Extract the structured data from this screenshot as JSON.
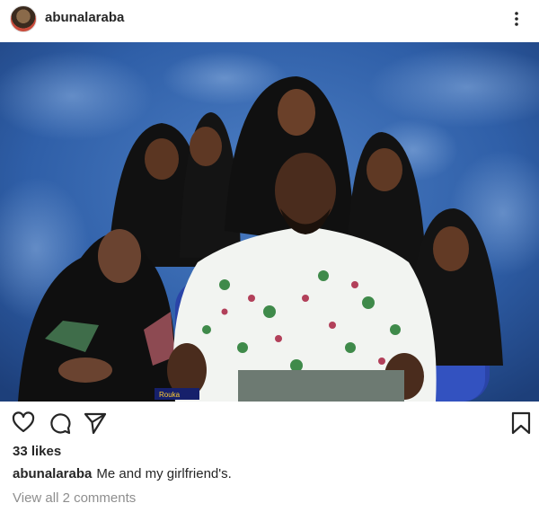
{
  "post": {
    "username": "abunalaraba",
    "likes_text": "33 likes",
    "caption": {
      "username": "abunalaraba",
      "text": "Me and my girlfriend's."
    },
    "view_comments": "View all 2 comments",
    "photo_corner_text": "Rouka"
  },
  "icons": {
    "more": "more-options-icon",
    "like": "heart-icon",
    "comment": "comment-bubble-icon",
    "share": "paper-plane-icon",
    "save": "bookmark-icon"
  },
  "colors": {
    "text": "#262626",
    "muted": "#8e8e8e",
    "backdrop": "#2f5fa8"
  }
}
